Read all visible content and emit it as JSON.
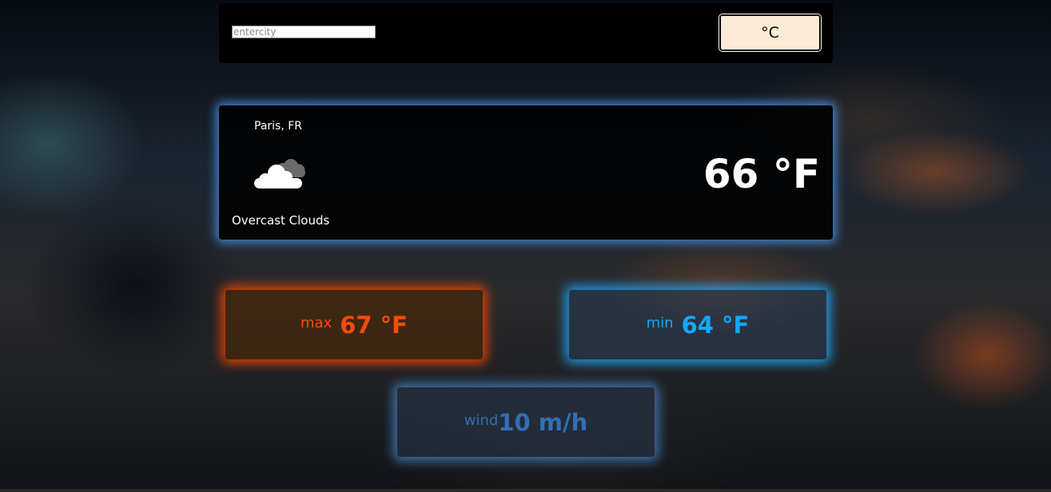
{
  "search": {
    "placeholder": "entercity",
    "value": "",
    "unit_button_label": "°C"
  },
  "weather": {
    "location": "Paris, FR",
    "icon": "cloud-icon",
    "condition": "Overcast Clouds",
    "temperature": "66 °F"
  },
  "stats": {
    "max": {
      "label": "max",
      "value": "67 °F"
    },
    "min": {
      "label": "min",
      "value": "64 °F"
    },
    "wind": {
      "label": "wind",
      "value": "10 m/h"
    }
  },
  "colors": {
    "glow_main": "#50a0ff",
    "max_accent": "#ff4a0a",
    "min_accent": "#14a8ff",
    "wind_accent": "#2f6fb5",
    "button_bg": "#fdebd7"
  }
}
